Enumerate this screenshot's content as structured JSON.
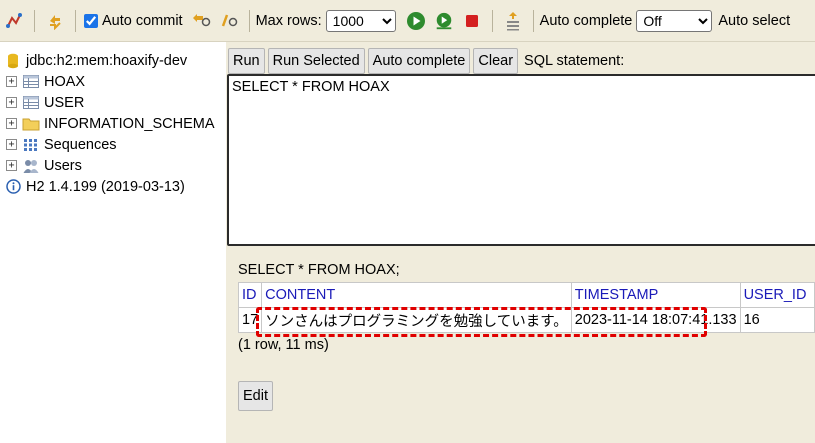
{
  "toolbar": {
    "auto_commit_label": "Auto commit",
    "auto_commit_checked": true,
    "max_rows_label": "Max rows:",
    "max_rows_value": "1000",
    "auto_complete_label": "Auto complete",
    "auto_complete_value": "Off",
    "auto_select_label": "Auto select"
  },
  "tree": {
    "connection": "jdbc:h2:mem:hoaxify-dev",
    "items": [
      {
        "label": "HOAX",
        "icon": "table-icon"
      },
      {
        "label": "USER",
        "icon": "table-icon"
      },
      {
        "label": "INFORMATION_SCHEMA",
        "icon": "folder-icon"
      },
      {
        "label": "Sequences",
        "icon": "sequences-icon"
      },
      {
        "label": "Users",
        "icon": "users-icon"
      }
    ],
    "version": "H2 1.4.199 (2019-03-13)"
  },
  "buttons": {
    "run": "Run",
    "run_selected": "Run Selected",
    "auto_complete": "Auto complete",
    "clear": "Clear",
    "sql_label": "SQL statement:"
  },
  "editor": {
    "sql": "SELECT * FROM HOAX"
  },
  "result": {
    "title": "SELECT * FROM HOAX;",
    "columns": [
      "ID",
      "CONTENT",
      "TIMESTAMP",
      "USER_ID"
    ],
    "rows": [
      [
        "17",
        "ソンさんはプログラミングを勉強しています。",
        "2023-11-14 18:07:41.133",
        "16"
      ]
    ],
    "summary": "(1 row, 11 ms)",
    "edit_label": "Edit"
  },
  "colors": {
    "panel_bg": "#f0ecdc",
    "header_text": "#1a1ab8",
    "highlight": "#e00000",
    "run_green": "#2e8b2e",
    "stop_red": "#d42020"
  }
}
